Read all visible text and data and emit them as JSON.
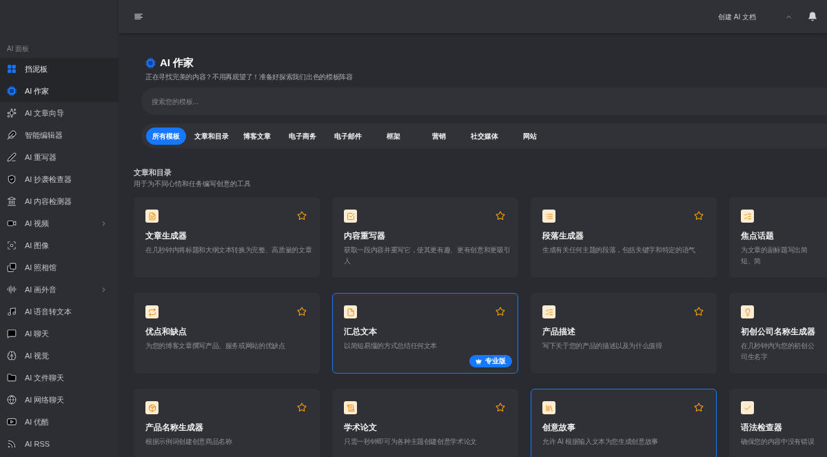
{
  "header": {
    "create_label": "创建 AI 文档"
  },
  "sidebar": {
    "section_label": "AI 面板",
    "items": [
      {
        "label": "挡泥板",
        "selected": true,
        "expandable": false
      },
      {
        "label": "AI 作家",
        "selected": true,
        "expandable": false
      },
      {
        "label": "AI 文章向导",
        "selected": false,
        "expandable": false
      },
      {
        "label": "智能编辑器",
        "selected": false,
        "expandable": false
      },
      {
        "label": "AI 重写器",
        "selected": false,
        "expandable": false
      },
      {
        "label": "AI 抄袭检查器",
        "selected": false,
        "expandable": false
      },
      {
        "label": "AI 内容检测器",
        "selected": false,
        "expandable": false
      },
      {
        "label": "AI 视频",
        "selected": false,
        "expandable": true
      },
      {
        "label": "AI 图像",
        "selected": false,
        "expandable": false
      },
      {
        "label": "AI 照相馆",
        "selected": false,
        "expandable": false
      },
      {
        "label": "AI 画外音",
        "selected": false,
        "expandable": true
      },
      {
        "label": "AI 语音转文本",
        "selected": false,
        "expandable": false
      },
      {
        "label": "AI 聊天",
        "selected": false,
        "expandable": false
      },
      {
        "label": "AI 视觉",
        "selected": false,
        "expandable": false
      },
      {
        "label": "AI 文件聊天",
        "selected": false,
        "expandable": false
      },
      {
        "label": "AI 网络聊天",
        "selected": false,
        "expandable": false
      },
      {
        "label": "AI 优酷",
        "selected": false,
        "expandable": false
      },
      {
        "label": "AI RSS",
        "selected": false,
        "expandable": false
      }
    ]
  },
  "page": {
    "title": "AI 作家",
    "subtitle": "正在寻找完美的内容？不用再观望了！准备好探索我们出色的模板阵容"
  },
  "search": {
    "placeholder": "搜索您的模板..."
  },
  "tabs": [
    {
      "label": "所有模板",
      "selected": true
    },
    {
      "label": "文章和目录",
      "selected": false
    },
    {
      "label": "博客文章",
      "selected": false
    },
    {
      "label": "电子商务",
      "selected": false
    },
    {
      "label": "电子邮件",
      "selected": false
    },
    {
      "label": "框架",
      "selected": false
    },
    {
      "label": "营销",
      "selected": false
    },
    {
      "label": "社交媒体",
      "selected": false
    },
    {
      "label": "网站",
      "selected": false
    }
  ],
  "section": {
    "title": "文章和目录",
    "subtitle": "用于为不同心情和任务编写创意的工具"
  },
  "cards": [
    {
      "title": "文章生成器",
      "description": "在几秒钟内将标题和大纲文本转换为完整、高质量的文章",
      "highlighted": false
    },
    {
      "title": "内容重写器",
      "description": "获取一段内容并重写它，使其更有趣、更有创意和更吸引人",
      "highlighted": false
    },
    {
      "title": "段落生成器",
      "description": "生成有关任何主题的段落，包括关键字和特定的语气",
      "highlighted": false
    },
    {
      "title": "焦点话题",
      "description": "为文章的副标题写出简短、简",
      "highlighted": false
    },
    {
      "title": "优点和缺点",
      "description": "为您的博客文章撰写产品、服务或网站的优缺点",
      "highlighted": false
    },
    {
      "title": "汇总文本",
      "description": "以简短易懂的方式总结任何文本",
      "highlighted": true,
      "badge": "专业版"
    },
    {
      "title": "产品描述",
      "description": "写下关于您的产品的描述以及为什么值得",
      "highlighted": false
    },
    {
      "title": "初创公司名称生成器",
      "description": "在几秒钟内为您的初创公司生名字",
      "highlighted": false
    },
    {
      "title": "产品名称生成器",
      "description": "根据示例词创建创意商品名称",
      "highlighted": false
    },
    {
      "title": "学术论文",
      "description": "只需一秒钟即可为各种主题创建创意学术论文",
      "highlighted": false
    },
    {
      "title": "创意故事",
      "description": "允许 AI 根据输入文本为您生成创意故事",
      "highlighted": true
    },
    {
      "title": "语法检查器",
      "description": "确保您的内容中没有错误",
      "highlighted": false
    }
  ]
}
